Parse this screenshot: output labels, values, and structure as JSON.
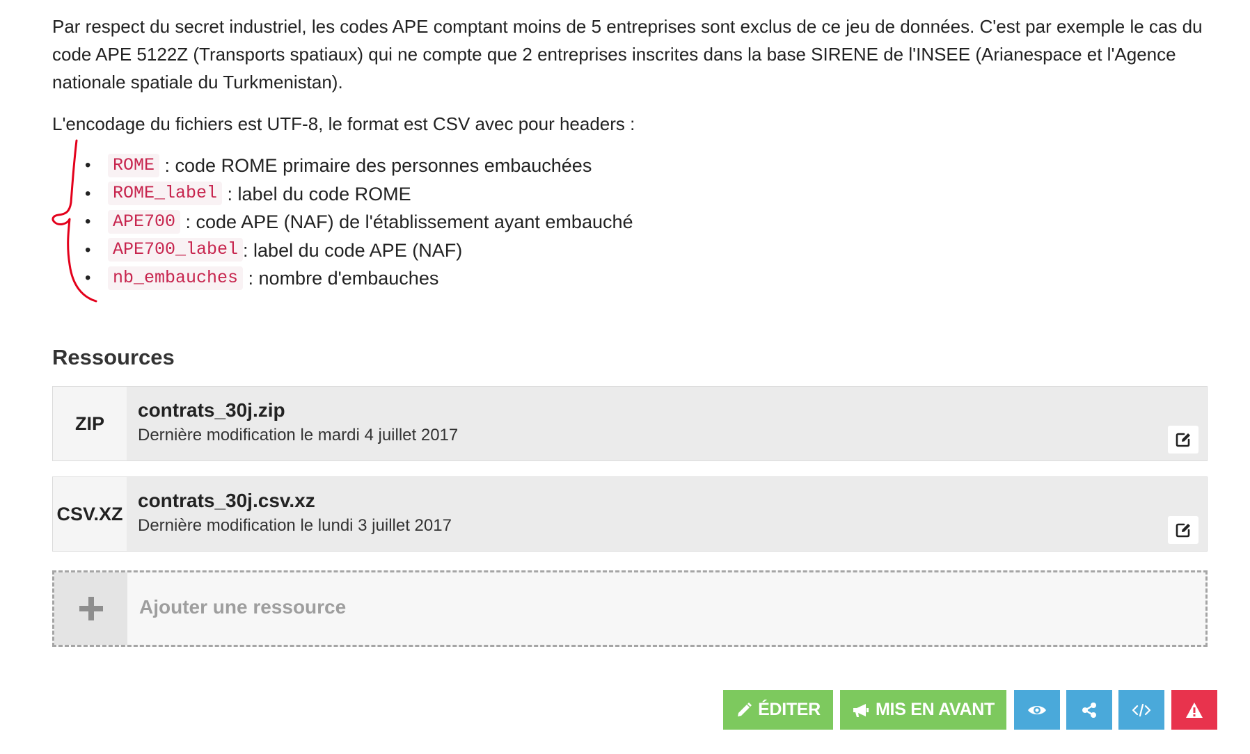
{
  "description": {
    "paragraph_1": "Par respect du secret industriel, les codes APE comptant moins de 5 entreprises sont exclus de ce jeu de données. C'est par exemple le cas du code APE 5122Z (Transports spatiaux) qui ne compte que 2 entreprises inscrites dans la base SIRENE de l'INSEE (Arianespace et l'Agence nationale spatiale du Turkmenistan).",
    "paragraph_2": "L'encodage du fichiers est UTF-8, le format est CSV avec pour headers :",
    "headers": [
      {
        "code": "ROME",
        "text": " : code ROME primaire des personnes embauchées"
      },
      {
        "code": "ROME_label",
        "text": " : label du code ROME"
      },
      {
        "code": "APE700",
        "text": " : code APE (NAF) de l'établissement ayant embauché"
      },
      {
        "code": "APE700_label",
        "text": ": label du code APE (NAF)"
      },
      {
        "code": "nb_embauches",
        "text": " : nombre d'embauches"
      }
    ],
    "bullet": "•"
  },
  "resources": {
    "title": "Ressources",
    "items": [
      {
        "format": "ZIP",
        "name": "contrats_30j.zip",
        "modified": "Dernière modification le mardi 4 juillet 2017"
      },
      {
        "format": "CSV.XZ",
        "name": "contrats_30j.csv.xz",
        "modified": "Dernière modification le lundi 3 juillet 2017"
      }
    ],
    "add_label": "Ajouter une ressource"
  },
  "actions": {
    "edit_label": "ÉDITER",
    "feature_label": "MIS EN AVANT"
  },
  "colors": {
    "green": "#7dc95e",
    "blue": "#4aa9da",
    "red": "#e8334d",
    "code_text": "#c7254e",
    "annotation": "#e3001b"
  }
}
